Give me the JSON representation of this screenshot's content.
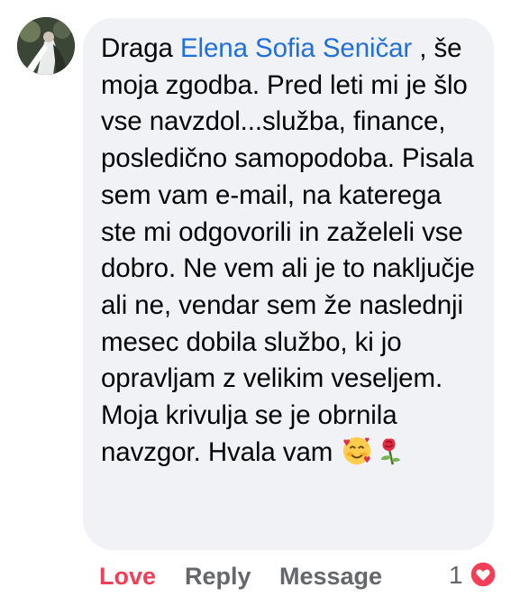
{
  "comment": {
    "greeting": "Draga ",
    "author_link": "Elena Sofia Seničar",
    "body": " , še moja zgodba. Pred leti mi je šlo vse navzdol...služba, finance, posledično samopodoba. Pisala sem vam e-mail, na katerega ste mi odgovorili in zaželeli vse dobro. Ne vem ali je to naključje ali ne, vendar sem že naslednji mesec dobila službo, ki jo opravljam z velikim veseljem. Moja krivulja se je obrnila navzgor. Hvala vam ",
    "emojis": [
      "smiling-face-with-hearts",
      "rose"
    ]
  },
  "actions": {
    "love_label": "Love",
    "reply_label": "Reply",
    "message_label": "Message"
  },
  "reactions": {
    "count": "1",
    "icon": "heart-reaction-icon"
  },
  "colors": {
    "love": "#f33e58",
    "link": "#216fdb",
    "muted": "#65676b",
    "bubble": "#f0f2f5"
  }
}
